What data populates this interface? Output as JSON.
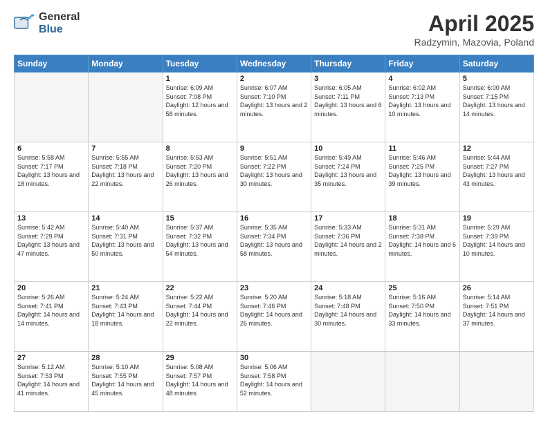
{
  "header": {
    "logo_general": "General",
    "logo_blue": "Blue",
    "month_title": "April 2025",
    "subtitle": "Radzymin, Mazovia, Poland"
  },
  "weekdays": [
    "Sunday",
    "Monday",
    "Tuesday",
    "Wednesday",
    "Thursday",
    "Friday",
    "Saturday"
  ],
  "weeks": [
    [
      {
        "day": "",
        "sunrise": "",
        "sunset": "",
        "daylight": ""
      },
      {
        "day": "",
        "sunrise": "",
        "sunset": "",
        "daylight": ""
      },
      {
        "day": "1",
        "sunrise": "Sunrise: 6:09 AM",
        "sunset": "Sunset: 7:08 PM",
        "daylight": "Daylight: 12 hours and 58 minutes."
      },
      {
        "day": "2",
        "sunrise": "Sunrise: 6:07 AM",
        "sunset": "Sunset: 7:10 PM",
        "daylight": "Daylight: 13 hours and 2 minutes."
      },
      {
        "day": "3",
        "sunrise": "Sunrise: 6:05 AM",
        "sunset": "Sunset: 7:11 PM",
        "daylight": "Daylight: 13 hours and 6 minutes."
      },
      {
        "day": "4",
        "sunrise": "Sunrise: 6:02 AM",
        "sunset": "Sunset: 7:13 PM",
        "daylight": "Daylight: 13 hours and 10 minutes."
      },
      {
        "day": "5",
        "sunrise": "Sunrise: 6:00 AM",
        "sunset": "Sunset: 7:15 PM",
        "daylight": "Daylight: 13 hours and 14 minutes."
      }
    ],
    [
      {
        "day": "6",
        "sunrise": "Sunrise: 5:58 AM",
        "sunset": "Sunset: 7:17 PM",
        "daylight": "Daylight: 13 hours and 18 minutes."
      },
      {
        "day": "7",
        "sunrise": "Sunrise: 5:55 AM",
        "sunset": "Sunset: 7:18 PM",
        "daylight": "Daylight: 13 hours and 22 minutes."
      },
      {
        "day": "8",
        "sunrise": "Sunrise: 5:53 AM",
        "sunset": "Sunset: 7:20 PM",
        "daylight": "Daylight: 13 hours and 26 minutes."
      },
      {
        "day": "9",
        "sunrise": "Sunrise: 5:51 AM",
        "sunset": "Sunset: 7:22 PM",
        "daylight": "Daylight: 13 hours and 30 minutes."
      },
      {
        "day": "10",
        "sunrise": "Sunrise: 5:49 AM",
        "sunset": "Sunset: 7:24 PM",
        "daylight": "Daylight: 13 hours and 35 minutes."
      },
      {
        "day": "11",
        "sunrise": "Sunrise: 5:46 AM",
        "sunset": "Sunset: 7:25 PM",
        "daylight": "Daylight: 13 hours and 39 minutes."
      },
      {
        "day": "12",
        "sunrise": "Sunrise: 5:44 AM",
        "sunset": "Sunset: 7:27 PM",
        "daylight": "Daylight: 13 hours and 43 minutes."
      }
    ],
    [
      {
        "day": "13",
        "sunrise": "Sunrise: 5:42 AM",
        "sunset": "Sunset: 7:29 PM",
        "daylight": "Daylight: 13 hours and 47 minutes."
      },
      {
        "day": "14",
        "sunrise": "Sunrise: 5:40 AM",
        "sunset": "Sunset: 7:31 PM",
        "daylight": "Daylight: 13 hours and 50 minutes."
      },
      {
        "day": "15",
        "sunrise": "Sunrise: 5:37 AM",
        "sunset": "Sunset: 7:32 PM",
        "daylight": "Daylight: 13 hours and 54 minutes."
      },
      {
        "day": "16",
        "sunrise": "Sunrise: 5:35 AM",
        "sunset": "Sunset: 7:34 PM",
        "daylight": "Daylight: 13 hours and 58 minutes."
      },
      {
        "day": "17",
        "sunrise": "Sunrise: 5:33 AM",
        "sunset": "Sunset: 7:36 PM",
        "daylight": "Daylight: 14 hours and 2 minutes."
      },
      {
        "day": "18",
        "sunrise": "Sunrise: 5:31 AM",
        "sunset": "Sunset: 7:38 PM",
        "daylight": "Daylight: 14 hours and 6 minutes."
      },
      {
        "day": "19",
        "sunrise": "Sunrise: 5:29 AM",
        "sunset": "Sunset: 7:39 PM",
        "daylight": "Daylight: 14 hours and 10 minutes."
      }
    ],
    [
      {
        "day": "20",
        "sunrise": "Sunrise: 5:26 AM",
        "sunset": "Sunset: 7:41 PM",
        "daylight": "Daylight: 14 hours and 14 minutes."
      },
      {
        "day": "21",
        "sunrise": "Sunrise: 5:24 AM",
        "sunset": "Sunset: 7:43 PM",
        "daylight": "Daylight: 14 hours and 18 minutes."
      },
      {
        "day": "22",
        "sunrise": "Sunrise: 5:22 AM",
        "sunset": "Sunset: 7:44 PM",
        "daylight": "Daylight: 14 hours and 22 minutes."
      },
      {
        "day": "23",
        "sunrise": "Sunrise: 5:20 AM",
        "sunset": "Sunset: 7:46 PM",
        "daylight": "Daylight: 14 hours and 26 minutes."
      },
      {
        "day": "24",
        "sunrise": "Sunrise: 5:18 AM",
        "sunset": "Sunset: 7:48 PM",
        "daylight": "Daylight: 14 hours and 30 minutes."
      },
      {
        "day": "25",
        "sunrise": "Sunrise: 5:16 AM",
        "sunset": "Sunset: 7:50 PM",
        "daylight": "Daylight: 14 hours and 33 minutes."
      },
      {
        "day": "26",
        "sunrise": "Sunrise: 5:14 AM",
        "sunset": "Sunset: 7:51 PM",
        "daylight": "Daylight: 14 hours and 37 minutes."
      }
    ],
    [
      {
        "day": "27",
        "sunrise": "Sunrise: 5:12 AM",
        "sunset": "Sunset: 7:53 PM",
        "daylight": "Daylight: 14 hours and 41 minutes."
      },
      {
        "day": "28",
        "sunrise": "Sunrise: 5:10 AM",
        "sunset": "Sunset: 7:55 PM",
        "daylight": "Daylight: 14 hours and 45 minutes."
      },
      {
        "day": "29",
        "sunrise": "Sunrise: 5:08 AM",
        "sunset": "Sunset: 7:57 PM",
        "daylight": "Daylight: 14 hours and 48 minutes."
      },
      {
        "day": "30",
        "sunrise": "Sunrise: 5:06 AM",
        "sunset": "Sunset: 7:58 PM",
        "daylight": "Daylight: 14 hours and 52 minutes."
      },
      {
        "day": "",
        "sunrise": "",
        "sunset": "",
        "daylight": ""
      },
      {
        "day": "",
        "sunrise": "",
        "sunset": "",
        "daylight": ""
      },
      {
        "day": "",
        "sunrise": "",
        "sunset": "",
        "daylight": ""
      }
    ]
  ]
}
